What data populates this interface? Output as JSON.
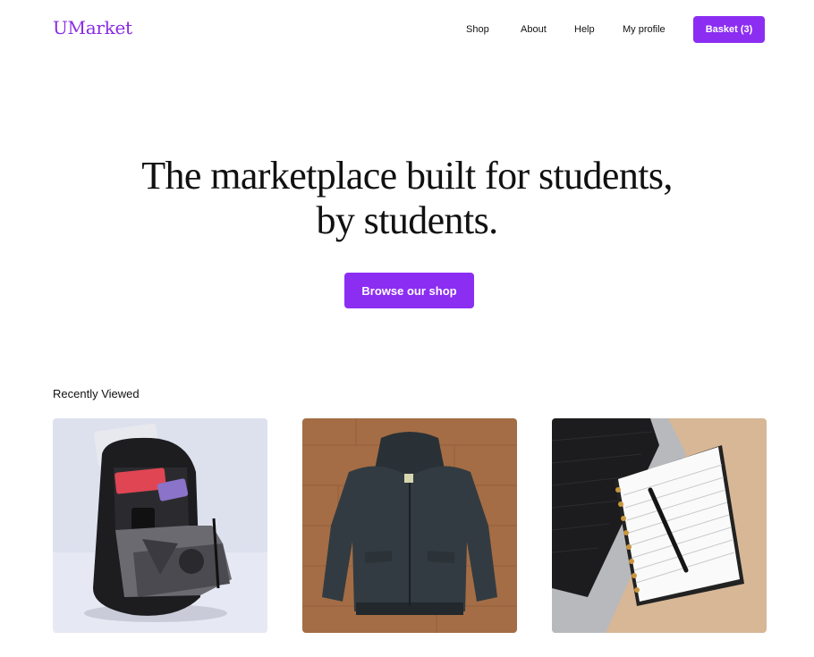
{
  "header": {
    "logo": "UMarket",
    "nav": [
      {
        "label": "Shop"
      },
      {
        "label": "About"
      },
      {
        "label": "Help"
      },
      {
        "label": "My profile"
      }
    ],
    "basket_label": "Basket (3)"
  },
  "hero": {
    "title_line1": "The marketplace built for students,",
    "title_line2": "by students.",
    "cta_label": "Browse our shop"
  },
  "recently_viewed": {
    "title": "Recently Viewed",
    "items": [
      {
        "image": "backpack-photo"
      },
      {
        "image": "hooded-jacket-photo"
      },
      {
        "image": "notebook-laptop-photo"
      }
    ]
  },
  "colors": {
    "accent": "#8b2ef2"
  }
}
